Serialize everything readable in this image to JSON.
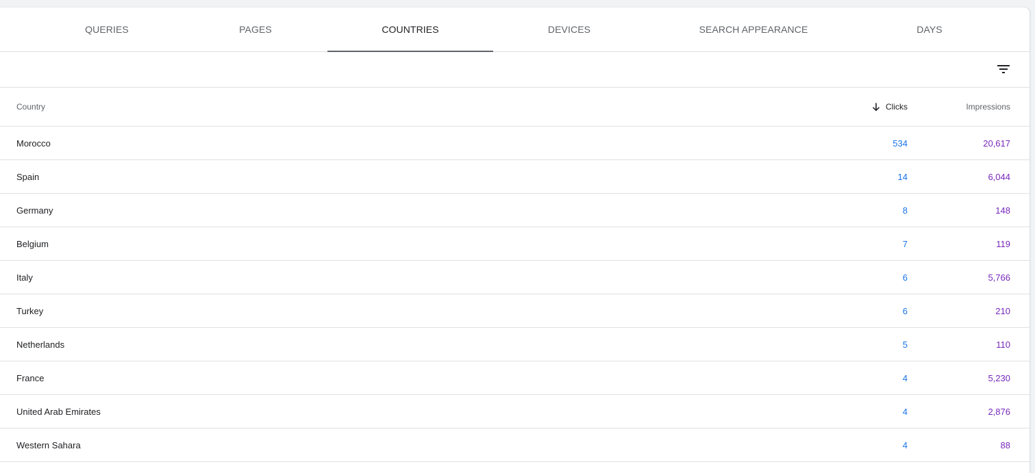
{
  "tabs": [
    {
      "label": "QUERIES"
    },
    {
      "label": "PAGES"
    },
    {
      "label": "COUNTRIES"
    },
    {
      "label": "DEVICES"
    },
    {
      "label": "SEARCH APPEARANCE"
    },
    {
      "label": "DAYS"
    }
  ],
  "active_tab": "COUNTRIES",
  "toolbar": {
    "filter_icon": "filter-icon"
  },
  "table": {
    "columns": {
      "country": "Country",
      "clicks": "Clicks",
      "impressions": "Impressions"
    },
    "sort": {
      "column": "Clicks",
      "direction": "descending"
    },
    "rows": [
      {
        "country": "Morocco",
        "clicks": "534",
        "impressions": "20,617"
      },
      {
        "country": "Spain",
        "clicks": "14",
        "impressions": "6,044"
      },
      {
        "country": "Germany",
        "clicks": "8",
        "impressions": "148"
      },
      {
        "country": "Belgium",
        "clicks": "7",
        "impressions": "119"
      },
      {
        "country": "Italy",
        "clicks": "6",
        "impressions": "5,766"
      },
      {
        "country": "Turkey",
        "clicks": "6",
        "impressions": "210"
      },
      {
        "country": "Netherlands",
        "clicks": "5",
        "impressions": "110"
      },
      {
        "country": "France",
        "clicks": "4",
        "impressions": "5,230"
      },
      {
        "country": "United Arab Emirates",
        "clicks": "4",
        "impressions": "2,876"
      },
      {
        "country": "Western Sahara",
        "clicks": "4",
        "impressions": "88"
      }
    ]
  },
  "colors": {
    "clicks": "#1a73e8",
    "impressions": "#7627bb",
    "active_tab_indicator": "#5f6368"
  }
}
